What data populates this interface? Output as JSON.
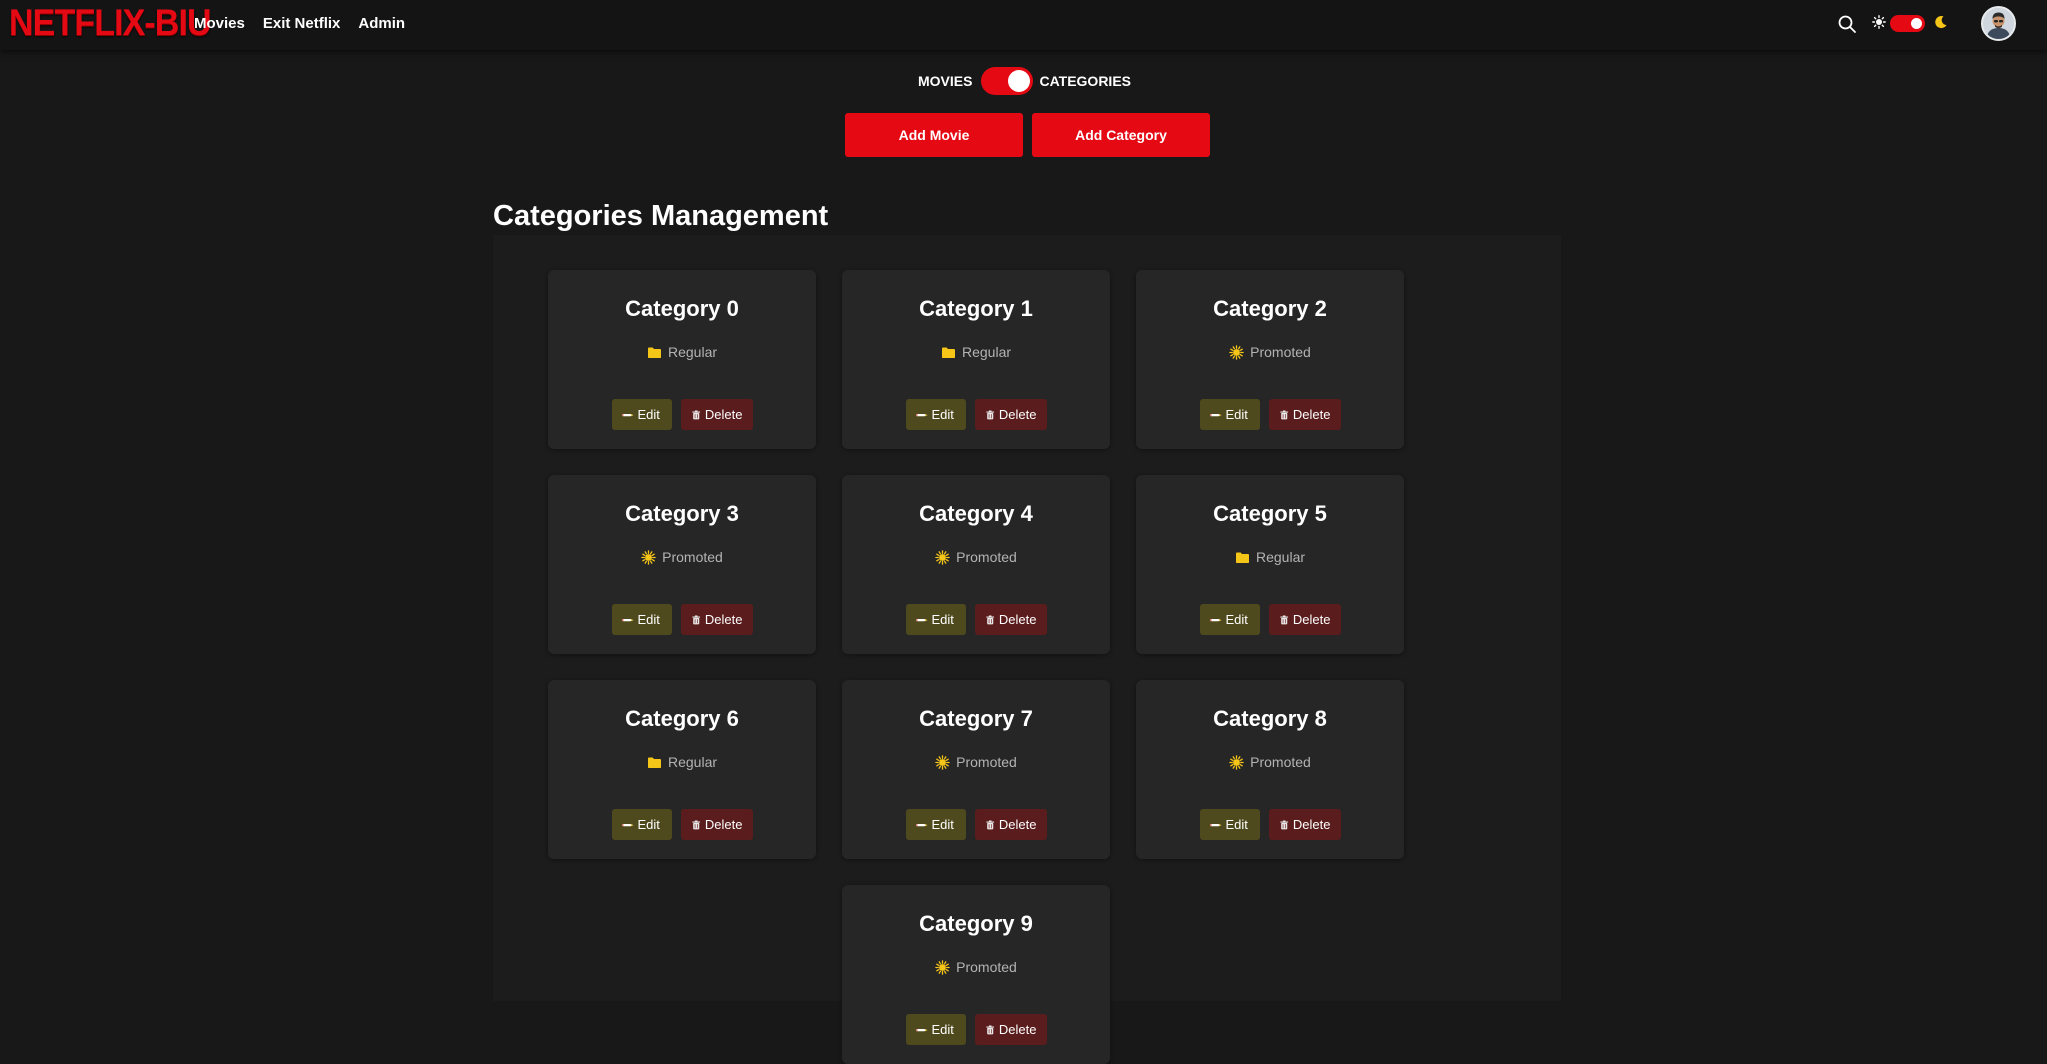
{
  "navbar": {
    "logo": "NETFLIX-BIU",
    "links": [
      "Movies",
      "Exit Netflix",
      "Admin"
    ],
    "icons": {
      "search": "search-icon",
      "theme_light": "sun-icon",
      "theme_dark": "moon-icon",
      "avatar": "user-avatar"
    },
    "theme_toggle_on": true
  },
  "mode_switch": {
    "left_label": "MOVIES",
    "right_label": "CATEGORIES",
    "selected": "CATEGORIES"
  },
  "actions": {
    "add_movie": "Add Movie",
    "add_category": "Add Category"
  },
  "section": {
    "title": "Categories Management"
  },
  "card_buttons": {
    "edit": "Edit",
    "delete": "Delete"
  },
  "categories": [
    {
      "name": "Category 0",
      "type": "Regular",
      "icon": "folder-icon"
    },
    {
      "name": "Category 1",
      "type": "Regular",
      "icon": "folder-icon"
    },
    {
      "name": "Category 2",
      "type": "Promoted",
      "icon": "sun-icon"
    },
    {
      "name": "Category 3",
      "type": "Promoted",
      "icon": "sun-icon"
    },
    {
      "name": "Category 4",
      "type": "Promoted",
      "icon": "sun-icon"
    },
    {
      "name": "Category 5",
      "type": "Regular",
      "icon": "folder-icon"
    },
    {
      "name": "Category 6",
      "type": "Regular",
      "icon": "folder-icon"
    },
    {
      "name": "Category 7",
      "type": "Promoted",
      "icon": "sun-icon"
    },
    {
      "name": "Category 8",
      "type": "Promoted",
      "icon": "sun-icon"
    },
    {
      "name": "Category 9",
      "type": "Promoted",
      "icon": "sun-icon"
    }
  ],
  "colors": {
    "brand_red": "#e50914",
    "background": "#181818",
    "card": "#262626",
    "edit_button": "#4f4a1d",
    "delete_button": "#5a1c1c",
    "folder_yellow": "#f5c518",
    "sun_yellow": "#f5c518"
  }
}
